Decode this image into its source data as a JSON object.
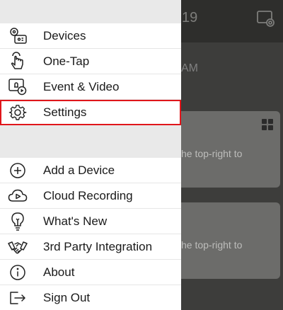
{
  "background": {
    "time_fragment": "19",
    "date_fragment": "AM",
    "card_text": "he top-right to",
    "card_text_2": "he top-right to"
  },
  "menu": {
    "group1": [
      {
        "id": "devices",
        "label": "Devices",
        "icon": "devices-icon"
      },
      {
        "id": "one-tap",
        "label": "One-Tap",
        "icon": "finger-tap-icon"
      },
      {
        "id": "event-video",
        "label": "Event & Video",
        "icon": "event-video-icon"
      },
      {
        "id": "settings",
        "label": "Settings",
        "icon": "gear-icon",
        "selected": true
      }
    ],
    "group2": [
      {
        "id": "add-device",
        "label": "Add a Device",
        "icon": "plus-circle-icon"
      },
      {
        "id": "cloud-recording",
        "label": "Cloud Recording",
        "icon": "cloud-play-icon"
      },
      {
        "id": "whats-new",
        "label": "What's New",
        "icon": "lightbulb-icon"
      },
      {
        "id": "third-party",
        "label": "3rd Party Integration",
        "icon": "handshake-icon"
      },
      {
        "id": "about",
        "label": "About",
        "icon": "info-icon"
      },
      {
        "id": "sign-out",
        "label": "Sign Out",
        "icon": "sign-out-icon"
      }
    ]
  },
  "colors": {
    "highlight": "#e0161b",
    "drawer_bg": "#ffffff",
    "separator": "#e9e9e9"
  }
}
